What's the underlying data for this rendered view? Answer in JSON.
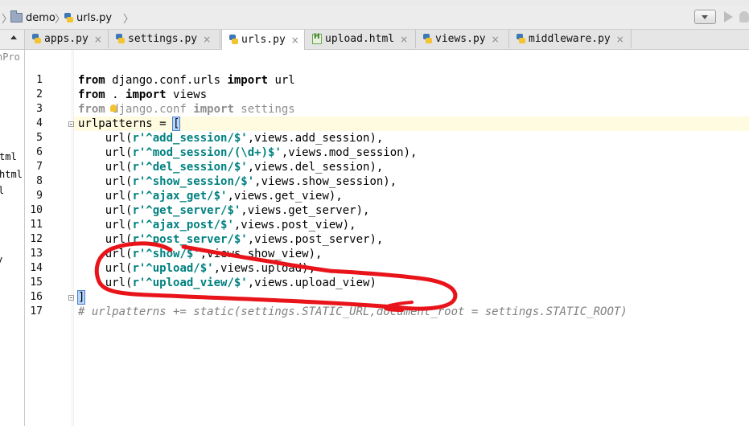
{
  "navbar": {
    "crumbs": [
      "demo",
      "urls.py"
    ]
  },
  "left_panel": {
    "items": [
      "nPro",
      "tml",
      "html",
      "l",
      "y"
    ]
  },
  "tabs": [
    {
      "label": "apps.py",
      "icon": "python-file-icon"
    },
    {
      "label": "settings.py",
      "icon": "python-file-icon"
    },
    {
      "label": "urls.py",
      "icon": "python-file-icon",
      "active": true
    },
    {
      "label": "upload.html",
      "icon": "html-file-icon"
    },
    {
      "label": "views.py",
      "icon": "python-file-icon"
    },
    {
      "label": "middleware.py",
      "icon": "python-file-icon"
    }
  ],
  "tab_close_glyph": "×",
  "editor": {
    "current_line": 4,
    "line_numbers": [
      "1",
      "2",
      "3",
      "4",
      "5",
      "6",
      "7",
      "8",
      "9",
      "10",
      "11",
      "12",
      "13",
      "14",
      "15",
      "16",
      "17"
    ],
    "lines": [
      [
        {
          "t": "from",
          "c": "kw2"
        },
        {
          "t": " django.conf.urls ",
          "c": ""
        },
        {
          "t": "import",
          "c": "kw2"
        },
        {
          "t": " url",
          "c": ""
        }
      ],
      [
        {
          "t": "from",
          "c": "kw2"
        },
        {
          "t": " . ",
          "c": ""
        },
        {
          "t": "import",
          "c": "kw2"
        },
        {
          "t": " views",
          "c": ""
        }
      ],
      [
        {
          "t": "from",
          "c": "dimkw"
        },
        {
          "t": " django.conf ",
          "c": "dim"
        },
        {
          "t": "import",
          "c": "dimkw"
        },
        {
          "t": " settings",
          "c": "dim"
        }
      ],
      [
        {
          "t": "urlpatterns = ",
          "c": ""
        },
        {
          "t": "[",
          "c": "bracket"
        }
      ],
      [
        {
          "t": "    url(",
          "c": ""
        },
        {
          "t": "r'^add_session/$'",
          "c": "str"
        },
        {
          "t": ",views.add_session),",
          "c": ""
        }
      ],
      [
        {
          "t": "    url(",
          "c": ""
        },
        {
          "t": "r'^mod_session/(\\d+)$'",
          "c": "str"
        },
        {
          "t": ",views.mod_session),",
          "c": ""
        }
      ],
      [
        {
          "t": "    url(",
          "c": ""
        },
        {
          "t": "r'^del_session/$'",
          "c": "str"
        },
        {
          "t": ",views.del_session),",
          "c": ""
        }
      ],
      [
        {
          "t": "    url(",
          "c": ""
        },
        {
          "t": "r'^show_session/$'",
          "c": "str"
        },
        {
          "t": ",views.show_session),",
          "c": ""
        }
      ],
      [
        {
          "t": "    url(",
          "c": ""
        },
        {
          "t": "r'^ajax_get/$'",
          "c": "str"
        },
        {
          "t": ",views.get_view),",
          "c": ""
        }
      ],
      [
        {
          "t": "    url(",
          "c": ""
        },
        {
          "t": "r'^get_server/$'",
          "c": "str"
        },
        {
          "t": ",views.get_server),",
          "c": ""
        }
      ],
      [
        {
          "t": "    url(",
          "c": ""
        },
        {
          "t": "r'^ajax_post/$'",
          "c": "str"
        },
        {
          "t": ",views.post_view),",
          "c": ""
        }
      ],
      [
        {
          "t": "    url(",
          "c": ""
        },
        {
          "t": "r'^post_server/$'",
          "c": "str"
        },
        {
          "t": ",views.post_server),",
          "c": ""
        }
      ],
      [
        {
          "t": "    url(",
          "c": ""
        },
        {
          "t": "r'^show/$'",
          "c": "str"
        },
        {
          "t": ",views.show_view),",
          "c": ""
        }
      ],
      [
        {
          "t": "    url(",
          "c": ""
        },
        {
          "t": "r'^upload/$'",
          "c": "str"
        },
        {
          "t": ",views.upload),",
          "c": ""
        }
      ],
      [
        {
          "t": "    url(",
          "c": ""
        },
        {
          "t": "r'^upload_view/$'",
          "c": "str"
        },
        {
          "t": ",views.upload_view)",
          "c": ""
        }
      ],
      [
        {
          "t": "]",
          "c": "bracket"
        }
      ],
      [
        {
          "t": "# urlpatterns += static(settings.STATIC_URL,document_root = settings.STATIC_ROOT)",
          "c": "cmt"
        }
      ]
    ]
  },
  "annotation": {
    "color": "#e8141a",
    "shape": "hand-drawn-loop-around-lines-13-15"
  }
}
